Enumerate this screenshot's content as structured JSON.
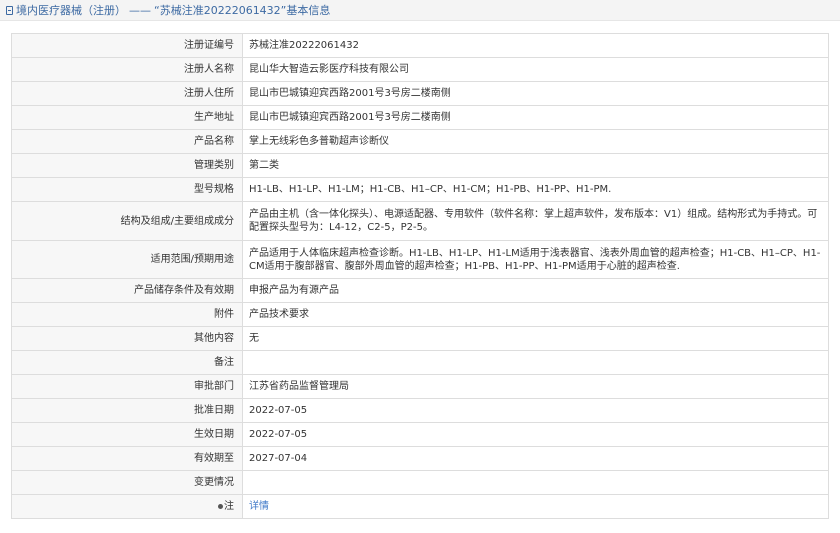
{
  "header": {
    "section": "境内医疗器械（注册）",
    "separator": "——",
    "title": "“苏械注准20222061432”基本信息"
  },
  "rows": [
    {
      "label": "注册证编号",
      "value": "苏械注准20222061432"
    },
    {
      "label": "注册人名称",
      "value": "昆山华大智造云影医疗科技有限公司"
    },
    {
      "label": "注册人住所",
      "value": "昆山市巴城镇迎宾西路2001号3号房二楼南侧"
    },
    {
      "label": "生产地址",
      "value": "昆山市巴城镇迎宾西路2001号3号房二楼南侧"
    },
    {
      "label": "产品名称",
      "value": "掌上无线彩色多普勒超声诊断仪"
    },
    {
      "label": "管理类别",
      "value": "第二类"
    },
    {
      "label": "型号规格",
      "value": "H1-LB、H1-LP、H1-LM；H1-CB、H1–CP、H1-CM；H1-PB、H1-PP、H1-PM."
    },
    {
      "label": "结构及组成/主要组成成分",
      "value": "产品由主机（含一体化探头）、电源适配器、专用软件（软件名称：掌上超声软件，发布版本：V1）组成。结构形式为手持式。可配置探头型号为：L4-12，C2-5，P2-5。"
    },
    {
      "label": "适用范围/预期用途",
      "value": "产品适用于人体临床超声检查诊断。H1-LB、H1-LP、H1-LM适用于浅表器官、浅表外周血管的超声检查；H1-CB、H1–CP、H1-CM适用于腹部器官、腹部外周血管的超声检查；H1-PB、H1-PP、H1-PM适用于心脏的超声检查."
    },
    {
      "label": "产品储存条件及有效期",
      "value": "申报产品为有源产品"
    },
    {
      "label": "附件",
      "value": "产品技术要求"
    },
    {
      "label": "其他内容",
      "value": "无"
    },
    {
      "label": "备注",
      "value": ""
    },
    {
      "label": "审批部门",
      "value": "江苏省药品监督管理局"
    },
    {
      "label": "批准日期",
      "value": "2022-07-05"
    },
    {
      "label": "生效日期",
      "value": "2022-07-05"
    },
    {
      "label": "有效期至",
      "value": "2027-07-04"
    },
    {
      "label": "变更情况",
      "value": ""
    }
  ],
  "note": {
    "label": "注",
    "link": "详情"
  }
}
